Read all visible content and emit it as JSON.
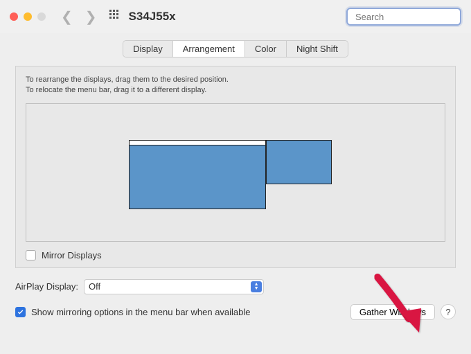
{
  "window": {
    "title": "S34J55x",
    "search_placeholder": "Search"
  },
  "tabs": {
    "display": "Display",
    "arrangement": "Arrangement",
    "color": "Color",
    "night_shift": "Night Shift"
  },
  "pane": {
    "instr_line1": "To rearrange the displays, drag them to the desired position.",
    "instr_line2": "To relocate the menu bar, drag it to a different display.",
    "mirror_label": "Mirror Displays"
  },
  "airplay": {
    "label": "AirPlay Display:",
    "value": "Off"
  },
  "footer": {
    "show_mirroring_label": "Show mirroring options in the menu bar when available",
    "gather_label": "Gather Windows",
    "help_label": "?"
  }
}
